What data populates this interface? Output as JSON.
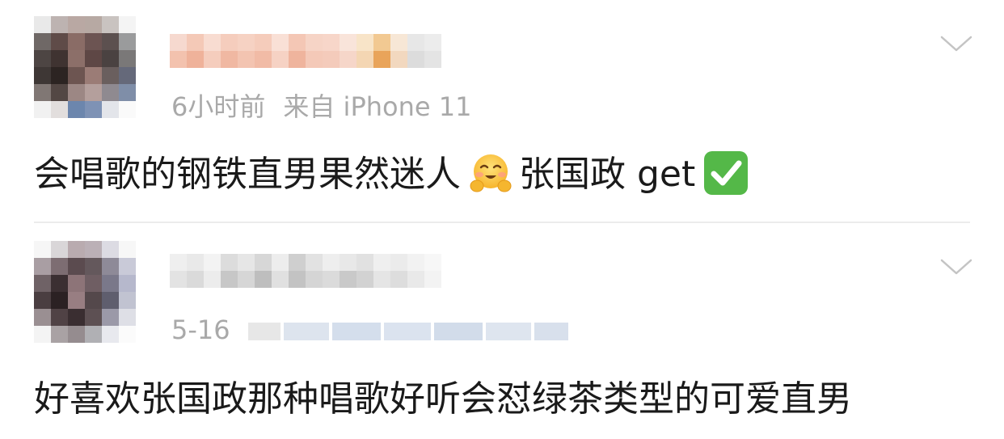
{
  "posts": [
    {
      "meta_time": "6小时前",
      "meta_source": "来自 iPhone 11",
      "content_text_1": "会唱歌的钢铁直男果然迷人",
      "content_text_2": "张国政 get",
      "emojis": [
        "hugging-face",
        "white-check-mark"
      ]
    },
    {
      "meta_time": "5-16",
      "content_text_1": "好喜欢张国政那种唱歌好听会怼绿茶类型的可爱直男"
    }
  ],
  "colors": {
    "meta_text": "#a9a9a9",
    "content_text": "#1a1a1a",
    "divider": "#ececec",
    "check_green": "#54b848"
  }
}
